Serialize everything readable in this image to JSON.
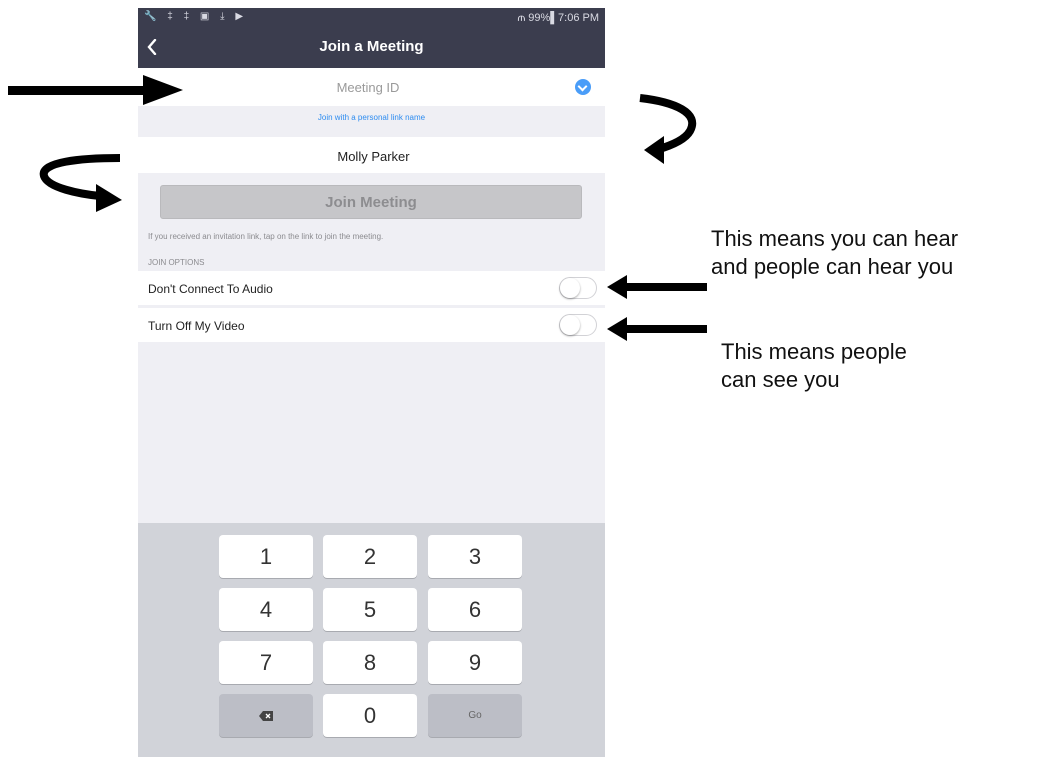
{
  "statusbar": {
    "left_icons": "🔧 ‡ ‡ ▣ ⤓ ▶",
    "right": "⫙ 99%▌7:06 PM"
  },
  "navbar": {
    "title": "Join a Meeting",
    "back_glyph": "‹"
  },
  "meeting_id": {
    "placeholder": "Meeting ID",
    "value": ""
  },
  "personal_link": "Join with a personal link name",
  "name": {
    "value": "Molly Parker"
  },
  "join_button": "Join Meeting",
  "invite_hint": "If you received an invitation link, tap on the link to join the meeting.",
  "options_heading": "JOIN OPTIONS",
  "options": [
    {
      "label": "Don't Connect To Audio",
      "on": false
    },
    {
      "label": "Turn Off My Video",
      "on": false
    }
  ],
  "keypad": {
    "keys": [
      "1",
      "2",
      "3",
      "4",
      "5",
      "6",
      "7",
      "8",
      "9",
      "",
      "0",
      "Go"
    ],
    "backspace_icon": "backspace-icon"
  },
  "annotations": {
    "audio": [
      "This means you can hear",
      "and people can hear you"
    ],
    "video": [
      "This means people",
      "can see you"
    ]
  },
  "colors": {
    "navbar": "#3b3d4e",
    "accent": "#4a9df8",
    "link": "#2d8cf0",
    "background": "#efeff4",
    "keypad": "#d1d3d9",
    "join_disabled": "#c6c6c9"
  }
}
